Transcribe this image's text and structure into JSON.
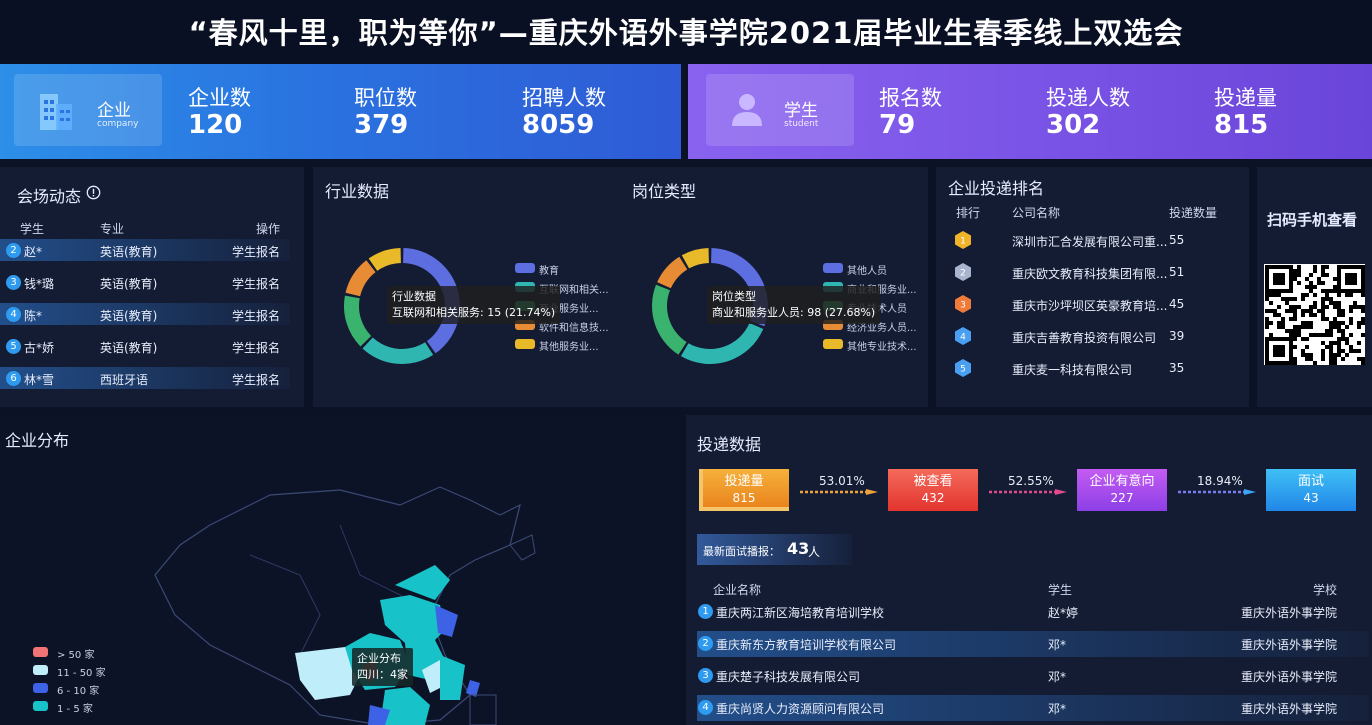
{
  "title": "“春风十里，职为等你”—重庆外语外事学院2021届毕业生春季线上双选会",
  "company_banner": {
    "label": "企业",
    "sub": "company",
    "stats": [
      {
        "label": "企业数",
        "value": "120"
      },
      {
        "label": "职位数",
        "value": "379"
      },
      {
        "label": "招聘人数",
        "value": "8059"
      }
    ]
  },
  "student_banner": {
    "label": "学生",
    "sub": "student",
    "stats": [
      {
        "label": "报名数",
        "value": "79"
      },
      {
        "label": "投递人数",
        "value": "302"
      },
      {
        "label": "投递量",
        "value": "815"
      }
    ]
  },
  "venue": {
    "title": "会场动态",
    "info_icon": "info-circle-icon",
    "headers": [
      "学生",
      "专业",
      "操作"
    ],
    "rows": [
      {
        "no": "2",
        "student": "赵*",
        "major": "英语(教育)",
        "action": "学生报名"
      },
      {
        "no": "3",
        "student": "钱*璐",
        "major": "英语(教育)",
        "action": "学生报名"
      },
      {
        "no": "4",
        "student": "陈*",
        "major": "英语(教育)",
        "action": "学生报名"
      },
      {
        "no": "5",
        "student": "古*娇",
        "major": "英语(教育)",
        "action": "学生报名"
      },
      {
        "no": "6",
        "student": "林*雪",
        "major": "西班牙语",
        "action": "学生报名"
      }
    ]
  },
  "industry": {
    "title": "行业数据",
    "legend": [
      "教育",
      "互联网和相关...",
      "商业服务业...",
      "软件和信息技...",
      "其他服务业..."
    ],
    "tooltip": {
      "title": "行业数据",
      "text": "互联网和相关服务: 15 (21.74%)"
    }
  },
  "position": {
    "title": "岗位类型",
    "legend": [
      "其他人员",
      "商业和服务业...",
      "专业技术人员",
      "经济业务人员...",
      "其他专业技术..."
    ],
    "tooltip": {
      "title": "岗位类型",
      "text": "商业和服务业人员: 98 (27.68%)"
    }
  },
  "chart_data": [
    {
      "type": "pie",
      "title": "行业数据",
      "categories": [
        "教育",
        "互联网和相关...",
        "商业服务业...",
        "软件和信息技...",
        "其他服务业..."
      ],
      "values": [
        28,
        15,
        11,
        8,
        7
      ],
      "colors": [
        "#5d6ee0",
        "#2fb6b1",
        "#3ab36f",
        "#e88b35",
        "#e8b928"
      ]
    },
    {
      "type": "pie",
      "title": "岗位类型",
      "categories": [
        "其他人员",
        "商业和服务业...",
        "专业技术人员",
        "经济业务人员...",
        "其他专业技术..."
      ],
      "values": [
        110,
        98,
        80,
        36,
        30
      ],
      "colors": [
        "#5d6ee0",
        "#2fb6b1",
        "#3ab36f",
        "#e88b35",
        "#e8b928"
      ]
    }
  ],
  "ranking": {
    "title": "企业投递排名",
    "headers": [
      "排行",
      "公司名称",
      "投递数量"
    ],
    "rows": [
      {
        "rank": "1",
        "name": "深圳市汇合发展有限公司重...",
        "count": "55",
        "color": "#f0b429"
      },
      {
        "rank": "2",
        "name": "重庆欧文教育科技集团有限...",
        "count": "51",
        "color": "#a9b4cf"
      },
      {
        "rank": "3",
        "name": "重庆市沙坪坝区英豪教育培...",
        "count": "45",
        "color": "#f07a3a"
      },
      {
        "rank": "4",
        "name": "重庆吉善教育投资有限公司",
        "count": "39",
        "color": "#4a9ff0"
      },
      {
        "rank": "5",
        "name": "重庆麦一科技有限公司",
        "count": "35",
        "color": "#4a9ff0"
      }
    ]
  },
  "qr": {
    "title": "扫码手机查看"
  },
  "map": {
    "title": "企业分布",
    "legend": [
      {
        "label": "> 50 家",
        "color": "#f07474"
      },
      {
        "label": "11 - 50 家",
        "color": "#bfeefa"
      },
      {
        "label": "6 - 10 家",
        "color": "#3e62e6"
      },
      {
        "label": "1 - 5 家",
        "color": "#17c2c8"
      }
    ],
    "tooltip": {
      "title": "企业分布",
      "text": "四川：4家"
    }
  },
  "delivery": {
    "title": "投递数据",
    "funnel": [
      {
        "label": "投递量",
        "value": "815"
      },
      {
        "label": "被查看",
        "value": "432"
      },
      {
        "label": "企业有意向",
        "value": "227"
      },
      {
        "label": "面试",
        "value": "43"
      }
    ],
    "rates": [
      "53.01%",
      "52.55%",
      "18.94%"
    ],
    "latest_label": "最新面试播报：",
    "latest_count": "43",
    "latest_unit": "人",
    "headers": [
      "企业名称",
      "学生",
      "学校"
    ],
    "rows": [
      {
        "no": "1",
        "company": "重庆两江新区海培教育培训学校",
        "student": "赵*婷",
        "school": "重庆外语外事学院"
      },
      {
        "no": "2",
        "company": "重庆新东方教育培训学校有限公司",
        "student": "邓*",
        "school": "重庆外语外事学院"
      },
      {
        "no": "3",
        "company": "重庆楚子科技发展有限公司",
        "student": "邓*",
        "school": "重庆外语外事学院"
      },
      {
        "no": "4",
        "company": "重庆尚贤人力资源顾问有限公司",
        "student": "邓*",
        "school": "重庆外语外事学院"
      }
    ]
  }
}
